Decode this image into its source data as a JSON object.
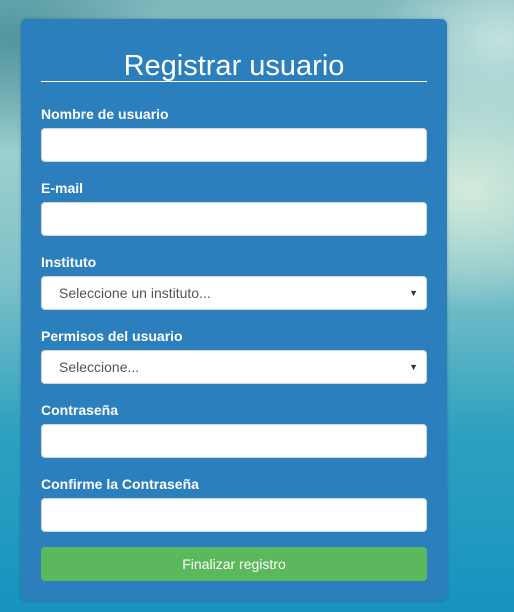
{
  "form": {
    "title": "Registrar usuario",
    "fields": {
      "username": {
        "label": "Nombre de usuario",
        "value": ""
      },
      "email": {
        "label": "E-mail",
        "value": ""
      },
      "institute": {
        "label": "Instituto",
        "selected": "Seleccione un instituto..."
      },
      "permissions": {
        "label": "Permisos del usuario",
        "selected": "Seleccione..."
      },
      "password": {
        "label": "Contraseña",
        "value": ""
      },
      "password_confirm": {
        "label": "Confirme la Contraseña",
        "value": ""
      }
    },
    "submit_label": "Finalizar registro"
  },
  "colors": {
    "card_background": "#2b7fbc",
    "submit_button": "#5cb85c",
    "text_on_card": "#ffffff"
  },
  "icons": {
    "select_caret": "triangle-down"
  }
}
